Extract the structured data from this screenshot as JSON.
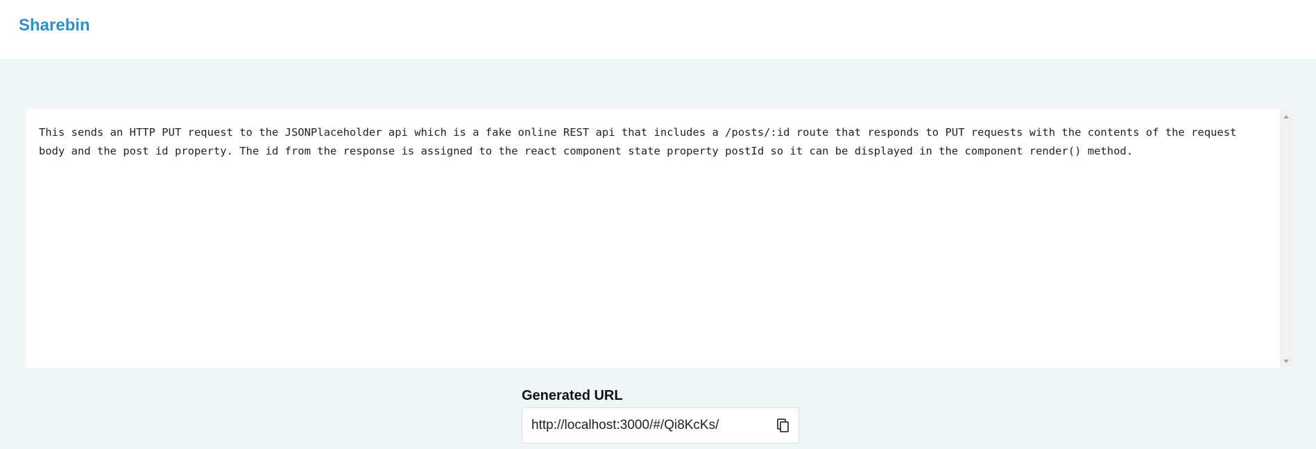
{
  "header": {
    "brand": "Sharebin"
  },
  "editor": {
    "content": "This sends an HTTP PUT request to the JSONPlaceholder api which is a fake online REST api that includes a /posts/:id route that responds to PUT requests with the contents of the request body and the post id property. The id from the response is assigned to the react component state property postId so it can be displayed in the component render() method."
  },
  "generated_url": {
    "label": "Generated URL",
    "value": "http://localhost:3000/#/Qi8KcKs/",
    "copy_icon": "copy-icon"
  },
  "colors": {
    "brand": "#2d8fc4",
    "background": "#eff6f5"
  }
}
